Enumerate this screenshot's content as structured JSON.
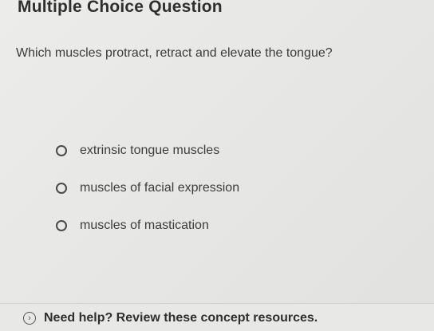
{
  "question": {
    "type_label": "Multiple Choice Question",
    "prompt": "Which muscles protract, retract and elevate the tongue?"
  },
  "choices": [
    {
      "label": "extrinsic tongue muscles",
      "selected": false
    },
    {
      "label": "muscles of facial expression",
      "selected": false
    },
    {
      "label": "muscles of mastication",
      "selected": false
    }
  ],
  "help": {
    "icon": "chevron-right-circle-icon",
    "text": "Need help? Review these concept resources."
  }
}
